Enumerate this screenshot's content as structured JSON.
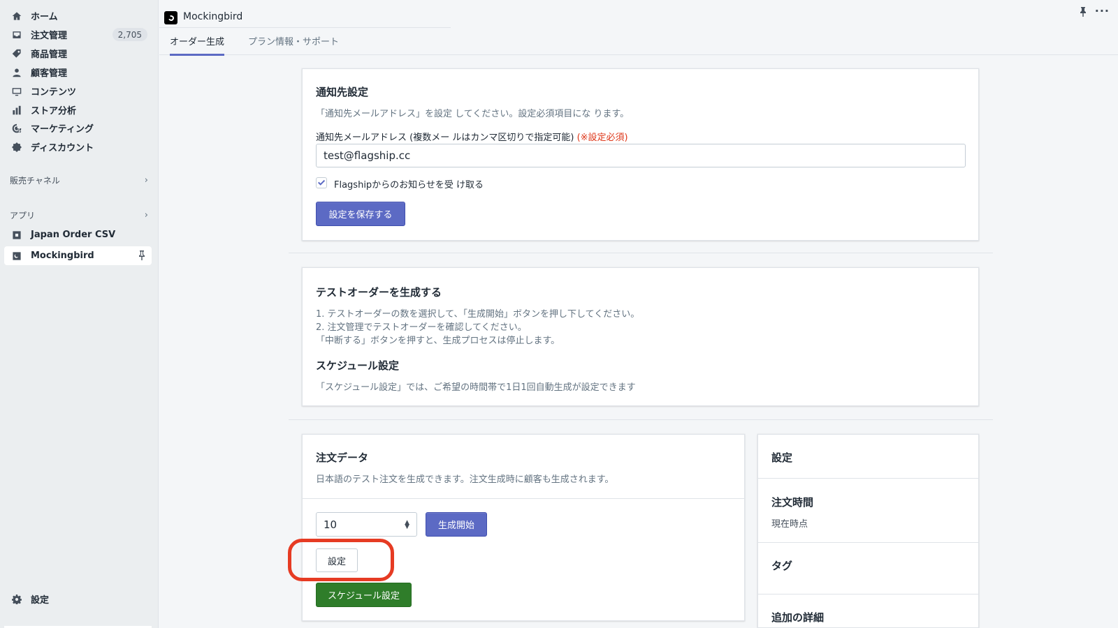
{
  "sidebar": {
    "items": [
      {
        "label": "ホーム",
        "icon": "home-icon"
      },
      {
        "label": "注文管理",
        "icon": "orders-icon",
        "badge": "2,705"
      },
      {
        "label": "商品管理",
        "icon": "tag-icon"
      },
      {
        "label": "顧客管理",
        "icon": "person-icon"
      },
      {
        "label": "コンテンツ",
        "icon": "content-icon"
      },
      {
        "label": "ストア分析",
        "icon": "analytics-icon"
      },
      {
        "label": "マーケティング",
        "icon": "marketing-icon"
      },
      {
        "label": "ディスカウント",
        "icon": "discount-icon"
      }
    ],
    "sales_channels_label": "販売チャネル",
    "apps_label": "アプリ",
    "apps": [
      {
        "label": "Japan Order CSV",
        "icon": "app-icon"
      },
      {
        "label": "Mockingbird",
        "icon": "app-icon",
        "active": true
      }
    ],
    "settings_label": "設定"
  },
  "topbar": {
    "app_title": "Mockingbird"
  },
  "tabs": [
    {
      "label": "オーダー生成",
      "active": true
    },
    {
      "label": "プラン情報・サポート",
      "active": false
    }
  ],
  "notification": {
    "title": "通知先設定",
    "description": "「通知先メールアドレス」を設定 してください。設定必須項目にな ります。",
    "email_label": "通知先メールアドレス (複数メー ルはカンマ区切りで指定可能)",
    "email_required": "(※設定必須)",
    "email_value": "test@flagship.cc",
    "checkbox_label": "Flagshipからのお知らせを受 け取る",
    "checkbox_checked": true,
    "save_button": "設定を保存する"
  },
  "test_order": {
    "title": "テストオーダーを生成する",
    "steps": [
      "1. テストオーダーの数を選択して、「生成開始」ボタンを押し下してください。",
      "2. 注文管理でテストオーダーを確認してください。",
      "「中断する」ボタンを押すと、生成プロセスは停止します。"
    ],
    "schedule_title": "スケジュール設定",
    "schedule_description": "「スケジュール設定」では、ご希望の時間帯で1日1回自動生成が設定できます"
  },
  "order_data": {
    "title": "注文データ",
    "description": "日本語のテスト注文を生成できます。注文生成時に顧客も生成されます。",
    "quantity_value": "10",
    "start_button": "生成開始",
    "settings_button": "設定",
    "schedule_button": "スケジュール設定"
  },
  "settings_panel": {
    "title": "設定",
    "order_time_label": "注文時間",
    "order_time_value": "現在時点",
    "tags_label": "タグ",
    "additional_details_label": "追加の詳細"
  },
  "colors": {
    "primary": "#5c6ac4",
    "green": "#2f7d2a",
    "required_red": "#de3618",
    "highlight_red": "#e63b23"
  }
}
